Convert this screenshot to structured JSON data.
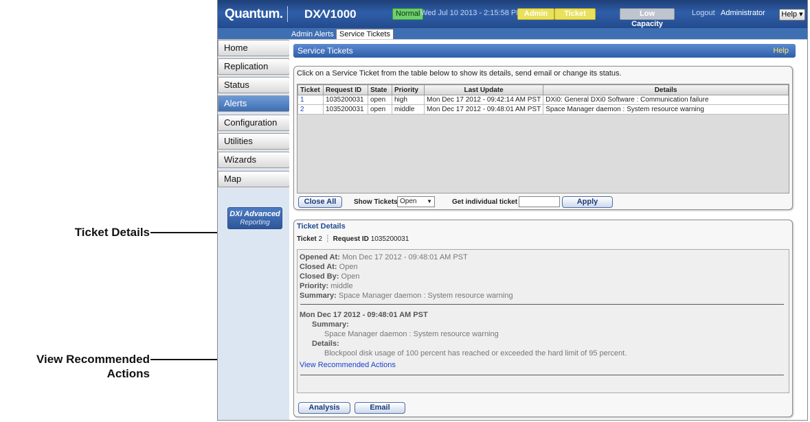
{
  "callouts": {
    "ticket_details": "Ticket Details",
    "view_recommended_line1": "View Recommended",
    "view_recommended_line2": "Actions"
  },
  "topbar": {
    "logo": "Quantum.",
    "product": "DX∕V1000",
    "status_badge": "Normal",
    "datetime": "Wed Jul 10 2013 - 2:15:58 PM PDT",
    "admin_badge": "Admin",
    "ticket_badge": "Ticket",
    "low_capacity_badge": "Low Capacity",
    "logout": "Logout",
    "username": "Administrator",
    "help": "Help ▾"
  },
  "subtabs": {
    "admin_alerts": "Admin Alerts",
    "service_tickets": "Service Tickets"
  },
  "sidebar": {
    "items": [
      {
        "label": "Home"
      },
      {
        "label": "Replication"
      },
      {
        "label": "Status"
      },
      {
        "label": "Alerts"
      },
      {
        "label": "Configuration"
      },
      {
        "label": "Utilities"
      },
      {
        "label": "Wizards"
      },
      {
        "label": "Map"
      }
    ],
    "dxi_logo_line1": "DXi Advanced",
    "dxi_logo_line2": "Reporting"
  },
  "main": {
    "header_title": "Service Tickets",
    "header_help": "Help",
    "instructions": "Click on a Service Ticket from the table below to show its details, send email or change its status.",
    "table": {
      "headers": [
        "Ticket",
        "Request ID",
        "State",
        "Priority",
        "Last Update",
        "Details"
      ],
      "rows": [
        {
          "ticket": "1",
          "request_id": "1035200031",
          "state": "open",
          "priority": "high",
          "last_update": "Mon Dec 17 2012 - 09:42:14 AM PST",
          "details": "DXi0: General DXi0 Software : Communication failure"
        },
        {
          "ticket": "2",
          "request_id": "1035200031",
          "state": "open",
          "priority": "middle",
          "last_update": "Mon Dec 17 2012 - 09:48:01 AM PST",
          "details": "Space Manager daemon : System resource warning"
        }
      ]
    },
    "controls": {
      "close_all": "Close All",
      "show_tickets_label": "Show Tickets",
      "show_tickets_value": "Open",
      "get_ticket_label": "Get individual ticket",
      "get_ticket_value": "",
      "apply": "Apply"
    }
  },
  "details": {
    "title": "Ticket Details",
    "ticket_label": "Ticket",
    "ticket_value": "2",
    "request_label": "Request ID",
    "request_value": "1035200031",
    "opened_label": "Opened At:",
    "opened_value": "Mon Dec 17 2012 - 09:48:01 AM PST",
    "closed_label": "Closed At:",
    "closed_value": "Open",
    "closed_by_label": "Closed By:",
    "closed_by_value": "Open",
    "priority_label": "Priority:",
    "priority_value": "middle",
    "summary_label": "Summary:",
    "summary_value": "Space Manager daemon : System resource warning",
    "entry_date": "Mon Dec 17 2012 - 09:48:01 AM PST",
    "entry_summary_label": "Summary:",
    "entry_summary_value": "Space Manager daemon : System resource warning",
    "entry_details_label": "Details:",
    "entry_details_value": "Blockpool disk usage of 100 percent has reached or exceeded the hard limit of 95 percent.",
    "view_link": "View Recommended Actions",
    "analysis_button": "Analysis",
    "email_button": "Email"
  }
}
